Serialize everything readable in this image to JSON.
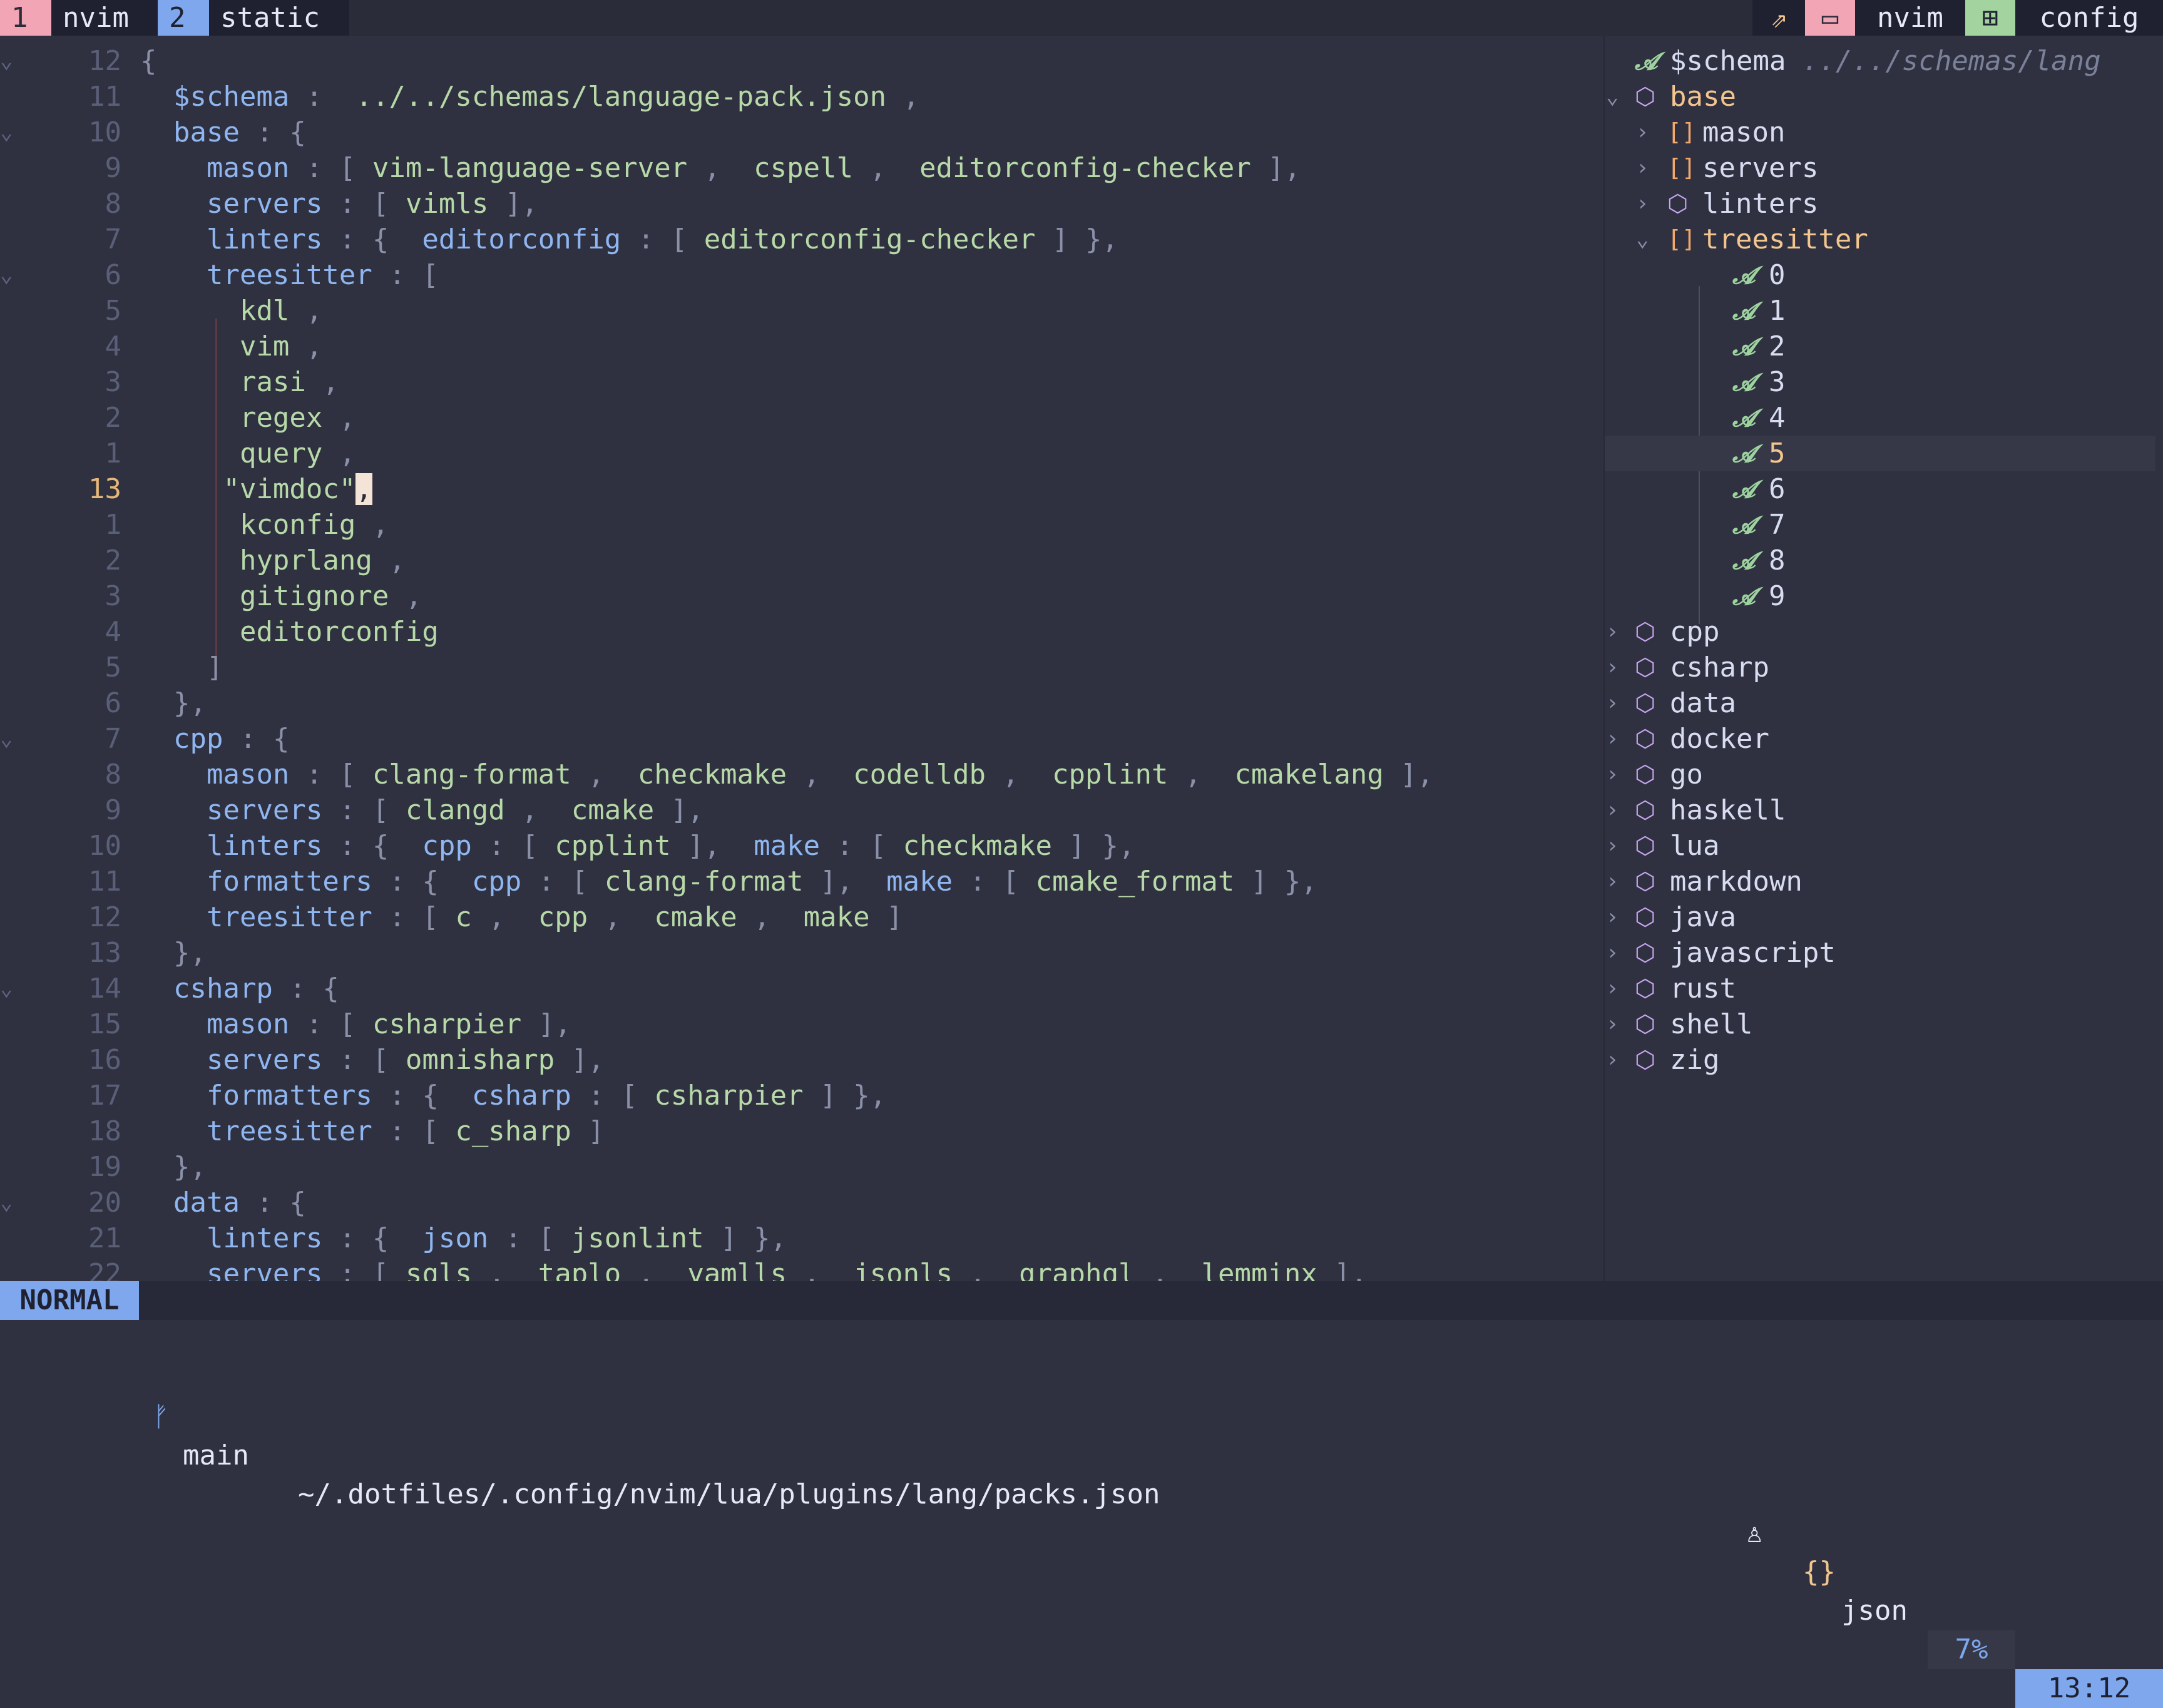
{
  "tmux": {
    "windows": [
      {
        "index": "1",
        "name": "nvim"
      },
      {
        "index": "2",
        "name": "static"
      }
    ],
    "right": {
      "icon1": "⇗",
      "icon2": "▭",
      "session_label": "nvim",
      "icon3": "⊞",
      "dir_label": "config"
    }
  },
  "editor": {
    "lines": [
      {
        "num": "12",
        "fold": "⌄",
        "tokens": [
          {
            "t": "{",
            "c": "p"
          }
        ]
      },
      {
        "num": "11",
        "tokens": [
          {
            "t": "  ",
            "c": "p"
          },
          {
            "t": "$schema",
            "c": "k"
          },
          {
            "t": " :  ",
            "c": "p"
          },
          {
            "t": "../../schemas/language-pack.json",
            "c": "s"
          },
          {
            "t": " ,",
            "c": "p"
          }
        ]
      },
      {
        "num": "10",
        "fold": "⌄",
        "tokens": [
          {
            "t": "  ",
            "c": "p"
          },
          {
            "t": "base",
            "c": "k"
          },
          {
            "t": " : {",
            "c": "p"
          }
        ]
      },
      {
        "num": "9",
        "tokens": [
          {
            "t": "    ",
            "c": "p"
          },
          {
            "t": "mason",
            "c": "k"
          },
          {
            "t": " : [ ",
            "c": "p"
          },
          {
            "t": "vim-language-server",
            "c": "s"
          },
          {
            "t": " ,  ",
            "c": "p"
          },
          {
            "t": "cspell",
            "c": "s"
          },
          {
            "t": " ,  ",
            "c": "p"
          },
          {
            "t": "editorconfig-checker",
            "c": "s"
          },
          {
            "t": " ],",
            "c": "p"
          }
        ]
      },
      {
        "num": "8",
        "tokens": [
          {
            "t": "    ",
            "c": "p"
          },
          {
            "t": "servers",
            "c": "k"
          },
          {
            "t": " : [ ",
            "c": "p"
          },
          {
            "t": "vimls",
            "c": "s"
          },
          {
            "t": " ],",
            "c": "p"
          }
        ]
      },
      {
        "num": "7",
        "tokens": [
          {
            "t": "    ",
            "c": "p"
          },
          {
            "t": "linters",
            "c": "k"
          },
          {
            "t": " : {  ",
            "c": "p"
          },
          {
            "t": "editorconfig",
            "c": "k"
          },
          {
            "t": " : [ ",
            "c": "p"
          },
          {
            "t": "editorconfig-checker",
            "c": "s"
          },
          {
            "t": " ] },",
            "c": "p"
          }
        ]
      },
      {
        "num": "6",
        "fold": "⌄",
        "tokens": [
          {
            "t": "    ",
            "c": "p"
          },
          {
            "t": "treesitter",
            "c": "k"
          },
          {
            "t": " : [",
            "c": "p"
          }
        ]
      },
      {
        "num": "5",
        "tokens": [
          {
            "t": "      ",
            "c": "p"
          },
          {
            "t": "kdl",
            "c": "s"
          },
          {
            "t": " ,",
            "c": "p"
          }
        ]
      },
      {
        "num": "4",
        "tokens": [
          {
            "t": "      ",
            "c": "p"
          },
          {
            "t": "vim",
            "c": "s"
          },
          {
            "t": " ,",
            "c": "p"
          }
        ]
      },
      {
        "num": "3",
        "tokens": [
          {
            "t": "      ",
            "c": "p"
          },
          {
            "t": "rasi",
            "c": "s"
          },
          {
            "t": " ,",
            "c": "p"
          }
        ]
      },
      {
        "num": "2",
        "tokens": [
          {
            "t": "      ",
            "c": "p"
          },
          {
            "t": "regex",
            "c": "s"
          },
          {
            "t": " ,",
            "c": "p"
          }
        ]
      },
      {
        "num": "1",
        "tokens": [
          {
            "t": "      ",
            "c": "p"
          },
          {
            "t": "query",
            "c": "s"
          },
          {
            "t": " ,",
            "c": "p"
          }
        ]
      },
      {
        "num": "13",
        "current": true,
        "tokens": [
          {
            "t": "     ",
            "c": "p"
          },
          {
            "t": "\"vimdoc\"",
            "c": "s"
          },
          {
            "t": ",",
            "c": "cursor"
          }
        ]
      },
      {
        "num": "1",
        "tokens": [
          {
            "t": "      ",
            "c": "p"
          },
          {
            "t": "kconfig",
            "c": "s"
          },
          {
            "t": " ,",
            "c": "p"
          }
        ]
      },
      {
        "num": "2",
        "tokens": [
          {
            "t": "      ",
            "c": "p"
          },
          {
            "t": "hyprlang",
            "c": "s"
          },
          {
            "t": " ,",
            "c": "p"
          }
        ]
      },
      {
        "num": "3",
        "tokens": [
          {
            "t": "      ",
            "c": "p"
          },
          {
            "t": "gitignore",
            "c": "s"
          },
          {
            "t": " ,",
            "c": "p"
          }
        ]
      },
      {
        "num": "4",
        "tokens": [
          {
            "t": "      ",
            "c": "p"
          },
          {
            "t": "editorconfig",
            "c": "s"
          }
        ]
      },
      {
        "num": "5",
        "tokens": [
          {
            "t": "    ",
            "c": "p"
          },
          {
            "t": "]",
            "c": "p"
          }
        ]
      },
      {
        "num": "6",
        "tokens": [
          {
            "t": "  ",
            "c": "p"
          },
          {
            "t": "},",
            "c": "p"
          }
        ]
      },
      {
        "num": "7",
        "fold": "⌄",
        "tokens": [
          {
            "t": "  ",
            "c": "p"
          },
          {
            "t": "cpp",
            "c": "k"
          },
          {
            "t": " : {",
            "c": "p"
          }
        ]
      },
      {
        "num": "8",
        "tokens": [
          {
            "t": "    ",
            "c": "p"
          },
          {
            "t": "mason",
            "c": "k"
          },
          {
            "t": " : [ ",
            "c": "p"
          },
          {
            "t": "clang-format",
            "c": "s"
          },
          {
            "t": " ,  ",
            "c": "p"
          },
          {
            "t": "checkmake",
            "c": "s"
          },
          {
            "t": " ,  ",
            "c": "p"
          },
          {
            "t": "codelldb",
            "c": "s"
          },
          {
            "t": " ,  ",
            "c": "p"
          },
          {
            "t": "cpplint",
            "c": "s"
          },
          {
            "t": " ,  ",
            "c": "p"
          },
          {
            "t": "cmakelang",
            "c": "s"
          },
          {
            "t": " ],",
            "c": "p"
          }
        ]
      },
      {
        "num": "9",
        "tokens": [
          {
            "t": "    ",
            "c": "p"
          },
          {
            "t": "servers",
            "c": "k"
          },
          {
            "t": " : [ ",
            "c": "p"
          },
          {
            "t": "clangd",
            "c": "s"
          },
          {
            "t": " ,  ",
            "c": "p"
          },
          {
            "t": "cmake",
            "c": "s"
          },
          {
            "t": " ],",
            "c": "p"
          }
        ]
      },
      {
        "num": "10",
        "tokens": [
          {
            "t": "    ",
            "c": "p"
          },
          {
            "t": "linters",
            "c": "k"
          },
          {
            "t": " : {  ",
            "c": "p"
          },
          {
            "t": "cpp",
            "c": "k"
          },
          {
            "t": " : [ ",
            "c": "p"
          },
          {
            "t": "cpplint",
            "c": "s"
          },
          {
            "t": " ],  ",
            "c": "p"
          },
          {
            "t": "make",
            "c": "k"
          },
          {
            "t": " : [ ",
            "c": "p"
          },
          {
            "t": "checkmake",
            "c": "s"
          },
          {
            "t": " ] },",
            "c": "p"
          }
        ]
      },
      {
        "num": "11",
        "tokens": [
          {
            "t": "    ",
            "c": "p"
          },
          {
            "t": "formatters",
            "c": "k"
          },
          {
            "t": " : {  ",
            "c": "p"
          },
          {
            "t": "cpp",
            "c": "k"
          },
          {
            "t": " : [ ",
            "c": "p"
          },
          {
            "t": "clang-format",
            "c": "s"
          },
          {
            "t": " ],  ",
            "c": "p"
          },
          {
            "t": "make",
            "c": "k"
          },
          {
            "t": " : [ ",
            "c": "p"
          },
          {
            "t": "cmake_format",
            "c": "s"
          },
          {
            "t": " ] },",
            "c": "p"
          }
        ]
      },
      {
        "num": "12",
        "tokens": [
          {
            "t": "    ",
            "c": "p"
          },
          {
            "t": "treesitter",
            "c": "k"
          },
          {
            "t": " : [ ",
            "c": "p"
          },
          {
            "t": "c",
            "c": "s"
          },
          {
            "t": " ,  ",
            "c": "p"
          },
          {
            "t": "cpp",
            "c": "s"
          },
          {
            "t": " ,  ",
            "c": "p"
          },
          {
            "t": "cmake",
            "c": "s"
          },
          {
            "t": " ,  ",
            "c": "p"
          },
          {
            "t": "make",
            "c": "s"
          },
          {
            "t": " ]",
            "c": "p"
          }
        ]
      },
      {
        "num": "13",
        "tokens": [
          {
            "t": "  ",
            "c": "p"
          },
          {
            "t": "},",
            "c": "p"
          }
        ]
      },
      {
        "num": "14",
        "fold": "⌄",
        "tokens": [
          {
            "t": "  ",
            "c": "p"
          },
          {
            "t": "csharp",
            "c": "k"
          },
          {
            "t": " : {",
            "c": "p"
          }
        ]
      },
      {
        "num": "15",
        "tokens": [
          {
            "t": "    ",
            "c": "p"
          },
          {
            "t": "mason",
            "c": "k"
          },
          {
            "t": " : [ ",
            "c": "p"
          },
          {
            "t": "csharpier",
            "c": "s"
          },
          {
            "t": " ],",
            "c": "p"
          }
        ]
      },
      {
        "num": "16",
        "tokens": [
          {
            "t": "    ",
            "c": "p"
          },
          {
            "t": "servers",
            "c": "k"
          },
          {
            "t": " : [ ",
            "c": "p"
          },
          {
            "t": "omnisharp",
            "c": "s"
          },
          {
            "t": " ],",
            "c": "p"
          }
        ]
      },
      {
        "num": "17",
        "tokens": [
          {
            "t": "    ",
            "c": "p"
          },
          {
            "t": "formatters",
            "c": "k"
          },
          {
            "t": " : {  ",
            "c": "p"
          },
          {
            "t": "csharp",
            "c": "k"
          },
          {
            "t": " : [ ",
            "c": "p"
          },
          {
            "t": "csharpier",
            "c": "s"
          },
          {
            "t": " ] },",
            "c": "p"
          }
        ]
      },
      {
        "num": "18",
        "tokens": [
          {
            "t": "    ",
            "c": "p"
          },
          {
            "t": "treesitter",
            "c": "k"
          },
          {
            "t": " : [ ",
            "c": "p"
          },
          {
            "t": "c_sharp",
            "c": "s"
          },
          {
            "t": " ]",
            "c": "p"
          }
        ]
      },
      {
        "num": "19",
        "tokens": [
          {
            "t": "  ",
            "c": "p"
          },
          {
            "t": "},",
            "c": "p"
          }
        ]
      },
      {
        "num": "20",
        "fold": "⌄",
        "tokens": [
          {
            "t": "  ",
            "c": "p"
          },
          {
            "t": "data",
            "c": "k"
          },
          {
            "t": " : {",
            "c": "p"
          }
        ]
      },
      {
        "num": "21",
        "tokens": [
          {
            "t": "    ",
            "c": "p"
          },
          {
            "t": "linters",
            "c": "k"
          },
          {
            "t": " : {  ",
            "c": "p"
          },
          {
            "t": "json",
            "c": "k"
          },
          {
            "t": " : [ ",
            "c": "p"
          },
          {
            "t": "jsonlint",
            "c": "s"
          },
          {
            "t": " ] },",
            "c": "p"
          }
        ]
      },
      {
        "num": "22",
        "tokens": [
          {
            "t": "    ",
            "c": "p"
          },
          {
            "t": "servers",
            "c": "k"
          },
          {
            "t": " : [ ",
            "c": "p"
          },
          {
            "t": "sqls",
            "c": "s"
          },
          {
            "t": " ,  ",
            "c": "p"
          },
          {
            "t": "taplo",
            "c": "s"
          },
          {
            "t": " ,  ",
            "c": "p"
          },
          {
            "t": "yamlls",
            "c": "s"
          },
          {
            "t": " ,  ",
            "c": "p"
          },
          {
            "t": "jsonls",
            "c": "s"
          },
          {
            "t": " ,  ",
            "c": "p"
          },
          {
            "t": "graphql",
            "c": "s"
          },
          {
            "t": " ,  ",
            "c": "p"
          },
          {
            "t": "lemminx",
            "c": "s"
          },
          {
            "t": " ],",
            "c": "p"
          }
        ]
      }
    ]
  },
  "outline": {
    "items": [
      {
        "depth": 0,
        "icon": "string",
        "label": "$schema",
        "value": "../../schemas/lang"
      },
      {
        "depth": 0,
        "chevron": "⌄",
        "icon": "object",
        "label": "base",
        "highlight": true
      },
      {
        "depth": 1,
        "chevron": "›",
        "icon": "array",
        "label": "mason"
      },
      {
        "depth": 1,
        "chevron": "›",
        "icon": "array",
        "label": "servers"
      },
      {
        "depth": 1,
        "chevron": "›",
        "icon": "object",
        "label": "linters"
      },
      {
        "depth": 1,
        "chevron": "⌄",
        "icon": "array",
        "label": "treesitter",
        "highlight": true
      },
      {
        "depth": 2,
        "icon": "string",
        "label": "0"
      },
      {
        "depth": 2,
        "icon": "string",
        "label": "1"
      },
      {
        "depth": 2,
        "icon": "string",
        "label": "2"
      },
      {
        "depth": 2,
        "icon": "string",
        "label": "3"
      },
      {
        "depth": 2,
        "icon": "string",
        "label": "4"
      },
      {
        "depth": 2,
        "icon": "string",
        "label": "5",
        "selected": true
      },
      {
        "depth": 2,
        "icon": "string",
        "label": "6"
      },
      {
        "depth": 2,
        "icon": "string",
        "label": "7"
      },
      {
        "depth": 2,
        "icon": "string",
        "label": "8"
      },
      {
        "depth": 2,
        "icon": "string",
        "label": "9"
      },
      {
        "depth": 0,
        "chevron": "›",
        "icon": "object",
        "label": "cpp"
      },
      {
        "depth": 0,
        "chevron": "›",
        "icon": "object",
        "label": "csharp"
      },
      {
        "depth": 0,
        "chevron": "›",
        "icon": "object",
        "label": "data"
      },
      {
        "depth": 0,
        "chevron": "›",
        "icon": "object",
        "label": "docker"
      },
      {
        "depth": 0,
        "chevron": "›",
        "icon": "object",
        "label": "go"
      },
      {
        "depth": 0,
        "chevron": "›",
        "icon": "object",
        "label": "haskell"
      },
      {
        "depth": 0,
        "chevron": "›",
        "icon": "object",
        "label": "lua"
      },
      {
        "depth": 0,
        "chevron": "›",
        "icon": "object",
        "label": "markdown"
      },
      {
        "depth": 0,
        "chevron": "›",
        "icon": "object",
        "label": "java"
      },
      {
        "depth": 0,
        "chevron": "›",
        "icon": "object",
        "label": "javascript"
      },
      {
        "depth": 0,
        "chevron": "›",
        "icon": "object",
        "label": "rust"
      },
      {
        "depth": 0,
        "chevron": "›",
        "icon": "object",
        "label": "shell"
      },
      {
        "depth": 0,
        "chevron": "›",
        "icon": "object",
        "label": "zig"
      }
    ],
    "icon_glyphs": {
      "string": "𝓐",
      "object": "⬡",
      "array": "[]"
    }
  },
  "statusline": {
    "mode": "NORMAL",
    "branch_icon": "ᚠ",
    "branch": "main",
    "path": "~/.dotfiles/.config/nvim/lua/plugins/lang/packs.json",
    "lsp_icon": "♙",
    "filetype_icon": "{}",
    "filetype": "json",
    "progress": "7%",
    "position": "13:12"
  }
}
